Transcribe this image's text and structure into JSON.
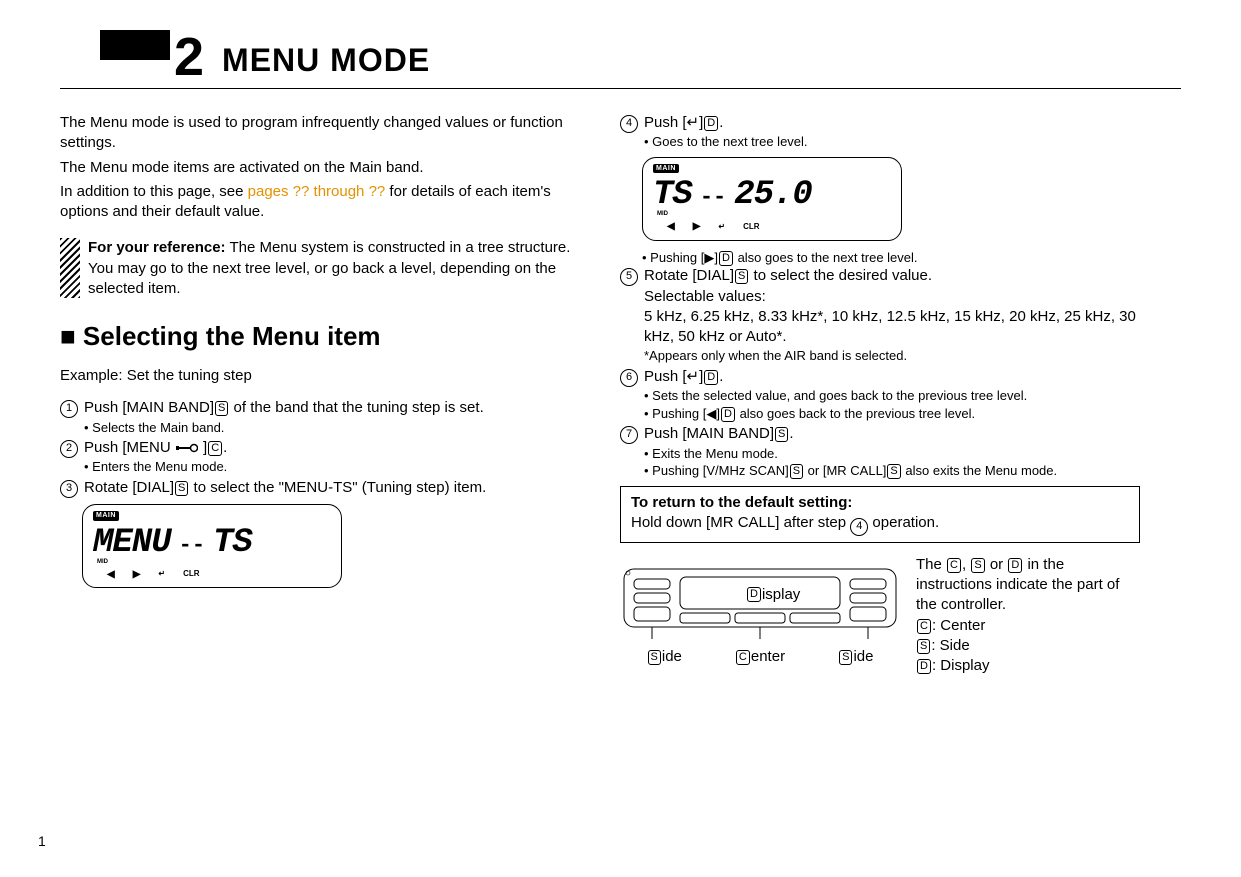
{
  "page_number": "1",
  "chapter": {
    "number": "2",
    "title": "MENU MODE"
  },
  "intro": {
    "p1": "The Menu mode is used to program infrequently changed values or function settings.",
    "p2": "The Menu mode items are activated on the Main band.",
    "p3a": "In addition to this page, see ",
    "p3_link": "pages ?? through ??",
    "p3b": " for details of each item's options and their default value."
  },
  "reference": {
    "lead": "For your reference:",
    "body": " The Menu system is constructed in a tree structure. You may go to the next tree level, or go back a level, depending on the selected item."
  },
  "section_heading": "■ Selecting the Menu item",
  "example_label": "Example: Set the tuning step",
  "steps_left": {
    "s1": {
      "num": "1",
      "pre": "Push [MAIN BAND]",
      "letter": "S",
      "post": " of the band that the tuning step is set.",
      "sub1": "• Selects the Main band."
    },
    "s2": {
      "num": "2",
      "pre": "Push [MENU ",
      "post1": "]",
      "letter": "C",
      "post2": ".",
      "sub1": "• Enters the Menu mode."
    },
    "s3": {
      "num": "3",
      "pre": "Rotate [DIAL]",
      "letter": "S",
      "post": " to select the \"MENU-TS\" (Tuning step) item."
    }
  },
  "lcd1": {
    "badge": "MAIN",
    "main_left": "MENU",
    "main_sep": "--",
    "main_right": "TS",
    "mid": "MID",
    "foot_left": "◀",
    "foot_mid": "▶",
    "foot_enter": "↵",
    "foot_clr": "CLR"
  },
  "steps_right": {
    "s4": {
      "num": "4",
      "pre": "Push [",
      "enter": "↵",
      "post1": "]",
      "letter": "D",
      "post2": ".",
      "sub1": "• Goes to the next tree level."
    },
    "s4_after": {
      "pre": "• Pushing [",
      "tri": "▶",
      "post1": "]",
      "letter": "D",
      "post2": " also goes to the next tree level."
    },
    "s5": {
      "num": "5",
      "pre": "Rotate [DIAL]",
      "letter": "S",
      "post": " to select the desired value.",
      "line2": "Selectable values:",
      "line3": "5 kHz, 6.25 kHz, 8.33 kHz*, 10 kHz, 12.5 kHz, 15 kHz, 20 kHz, 25 kHz, 30 kHz, 50 kHz or Auto*.",
      "line4": "*Appears only when the AIR band is selected."
    },
    "s6": {
      "num": "6",
      "pre": "Push [",
      "enter": "↵",
      "post1": "]",
      "letter": "D",
      "post2": ".",
      "sub1": "• Sets the selected value, and goes back to the previous tree level.",
      "sub2_pre": "• Pushing [",
      "sub2_tri": "◀",
      "sub2_post1": "]",
      "sub2_letter": "D",
      "sub2_post2": " also goes back to the previous tree level."
    },
    "s7": {
      "num": "7",
      "pre": "Push [MAIN BAND]",
      "letter": "S",
      "post": ".",
      "sub1": "• Exits the Menu mode.",
      "sub2_pre": "• Pushing [V/MHz SCAN]",
      "sub2_letter1": "S",
      "sub2_mid": " or [MR CALL]",
      "sub2_letter2": "S",
      "sub2_post": " also exits the Menu mode."
    }
  },
  "lcd2": {
    "badge": "MAIN",
    "main_left": "TS",
    "main_sep": "--",
    "main_right": "25.0",
    "mid": "MID",
    "foot_left": "◀",
    "foot_mid": "▶",
    "foot_enter": "↵",
    "foot_clr": "CLR"
  },
  "default_box": {
    "title": "To return to the default setting:",
    "body_pre": "Hold down [MR CALL] after step ",
    "step_num": "4",
    "body_post": " operation."
  },
  "controller": {
    "display_letter": "D",
    "display_word": "isplay",
    "side_letter": "S",
    "side_word": "ide",
    "center_letter": "C",
    "center_word": "enter"
  },
  "legend": {
    "line1_pre": "The ",
    "c": "C",
    "comma": ", ",
    "s": "S",
    "or": " or ",
    "d": "D",
    "line1_post": " in the instructions indicate the part of the controller.",
    "c_label": ": Center",
    "s_label": ": Side",
    "d_label": ": Display"
  }
}
